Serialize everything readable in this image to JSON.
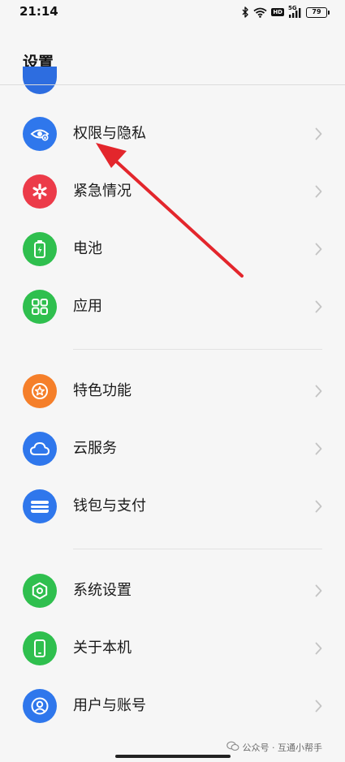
{
  "status_bar": {
    "time": "21:14",
    "network_label": "5G",
    "hd_label": "HD",
    "battery": "79",
    "icons": [
      "bluetooth-icon",
      "wifi-icon",
      "hd-icon",
      "signal-icon",
      "battery-icon"
    ]
  },
  "header": {
    "title": "设置"
  },
  "groups": [
    {
      "items": [
        {
          "label": "权限与隐私",
          "icon": "eye-lock-icon",
          "color": "#2f77ec"
        },
        {
          "label": "紧急情况",
          "icon": "emergency-asterisk-icon",
          "color": "#ec3b49"
        },
        {
          "label": "电池",
          "icon": "battery-charge-icon",
          "color": "#2fbf4e"
        },
        {
          "label": "应用",
          "icon": "apps-grid-icon",
          "color": "#2fbf4e"
        }
      ]
    },
    {
      "items": [
        {
          "label": "特色功能",
          "icon": "star-badge-icon",
          "color": "#f57f2a"
        },
        {
          "label": "云服务",
          "icon": "cloud-icon",
          "color": "#2f77ec"
        },
        {
          "label": "钱包与支付",
          "icon": "wallet-icon",
          "color": "#2f77ec"
        }
      ]
    },
    {
      "items": [
        {
          "label": "系统设置",
          "icon": "hexagon-gear-icon",
          "color": "#2fbf4e"
        },
        {
          "label": "关于本机",
          "icon": "phone-icon",
          "color": "#2fbf4e"
        },
        {
          "label": "用户与账号",
          "icon": "user-account-icon",
          "color": "#2f77ec"
        }
      ]
    }
  ],
  "annotation": {
    "type": "red-arrow",
    "color": "#e3262c",
    "points_to": "权限与隐私"
  },
  "watermark": {
    "text": "公众号 · 互通小帮手"
  }
}
